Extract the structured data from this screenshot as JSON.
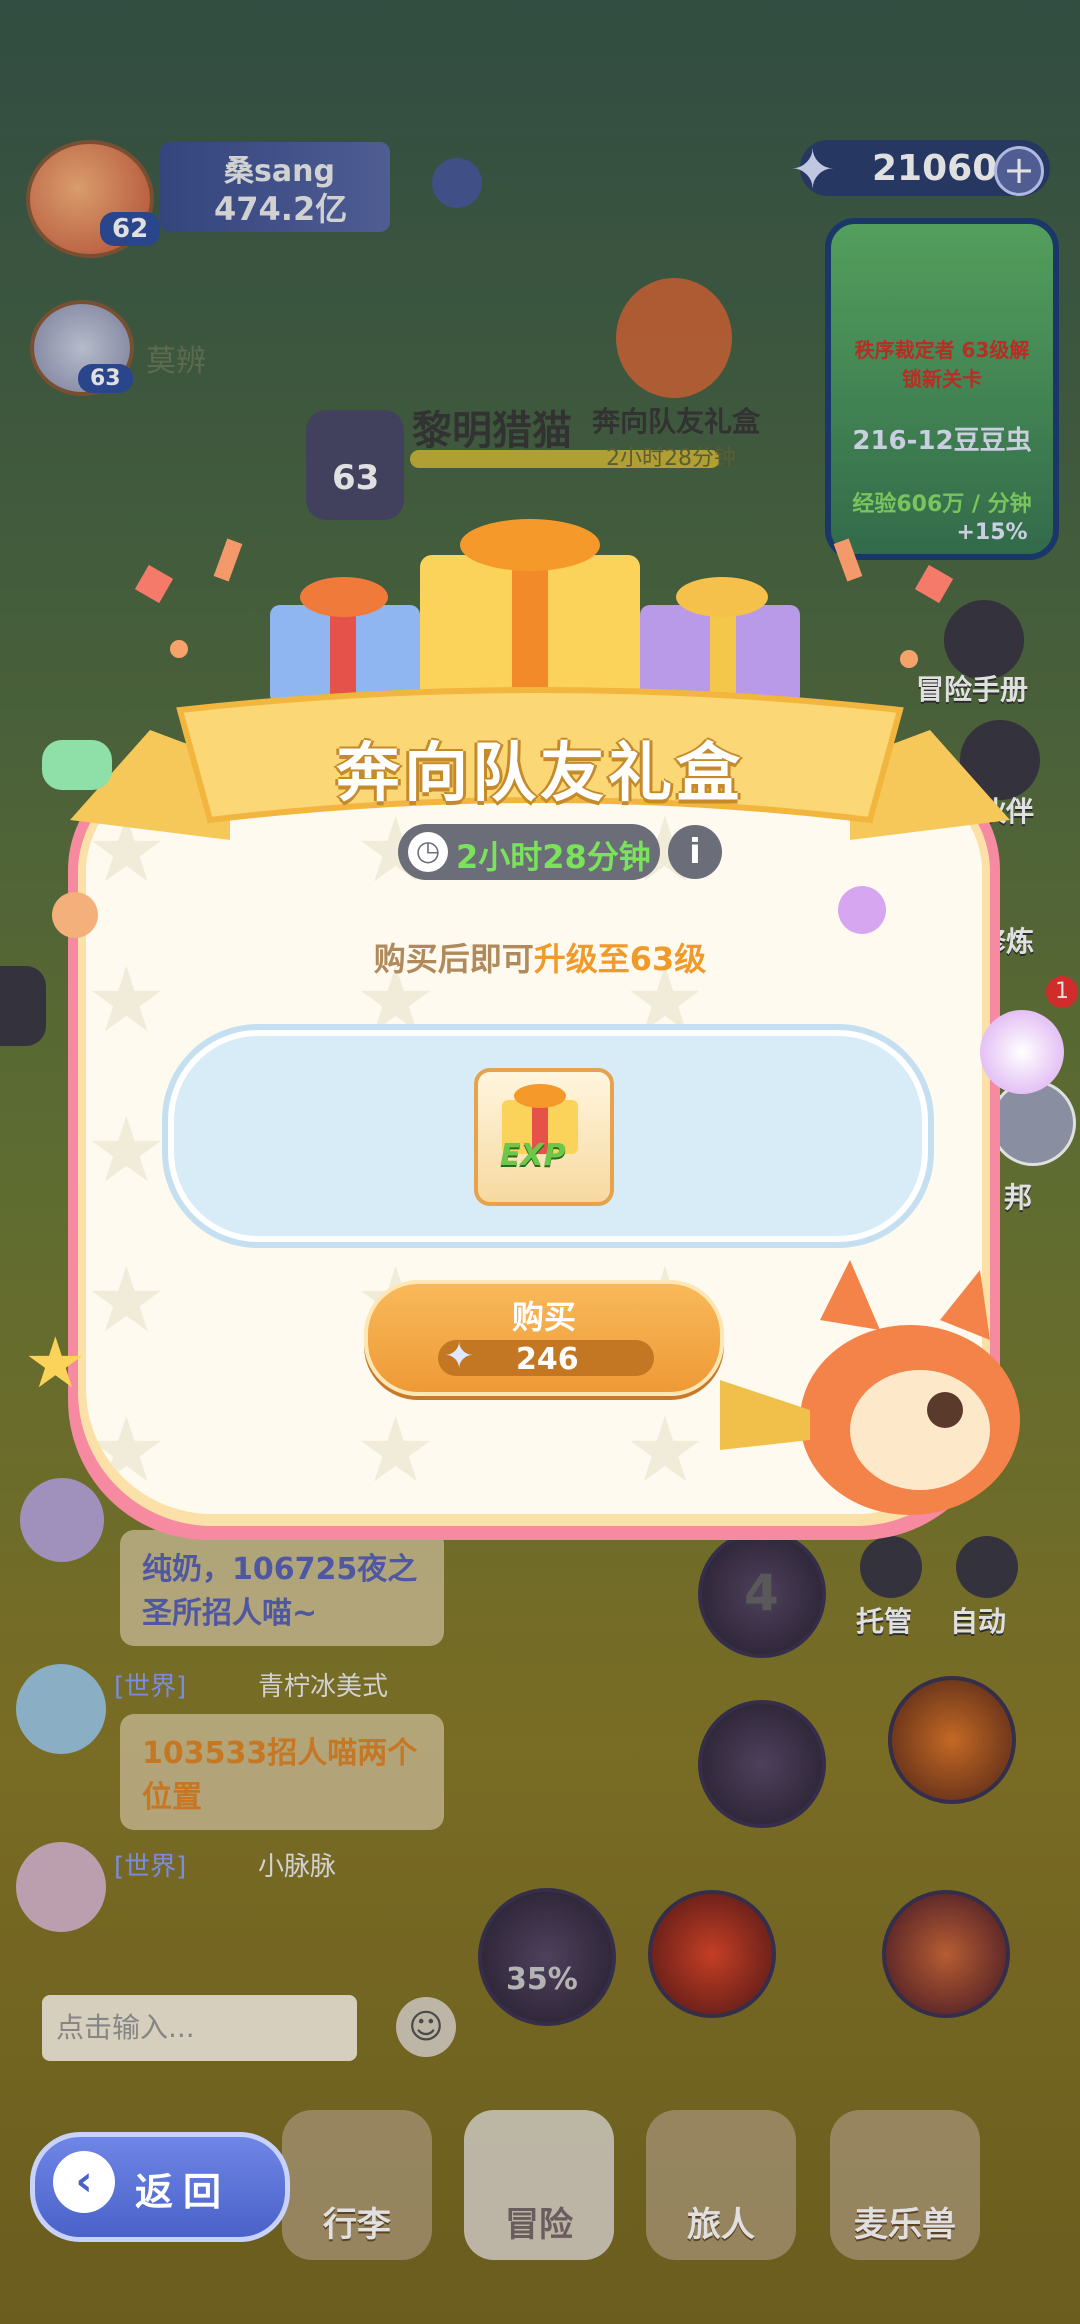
{
  "hud": {
    "player_name": "桑sang",
    "power": "474.2亿",
    "player_level": "62",
    "teammate_name": "莫辨",
    "teammate_level": "63",
    "boss_name": "黎明猎猫",
    "boss_level": "63",
    "gift_label": "奔向队友礼盒",
    "gift_timer": "2小时28分钟",
    "currency": "21060",
    "map_unlock": "秩序裁定者 63级解锁新关卡",
    "stage": "216-12豆豆虫",
    "exp_rate": "经验606万 / 分钟",
    "exp_bonus": "+15%",
    "side_adventure": "冒险手册",
    "side_partner": "伙伴",
    "side_train": "修炼",
    "side_bang": "邦",
    "notif_count": "1",
    "host_label": "托管",
    "auto_label": "自动",
    "skill_percent": "35%",
    "skill_count": "4"
  },
  "chat": {
    "msg1_text": "纯奶，106725夜之圣所招人喵~",
    "msg2_tag": "[世界]",
    "msg2_name": "青柠冰美式",
    "msg2_text": "103533招人喵两个位置",
    "msg3_tag": "[世界]",
    "msg3_name": "小脉脉",
    "input_placeholder": "点击输入..."
  },
  "bottom_nav": {
    "bag": "行李",
    "adventure": "冒险",
    "traveler": "旅人",
    "beast": "麦乐兽",
    "back": "返回"
  },
  "modal": {
    "title": "奔向队友礼盒",
    "timer": "2小时28分钟",
    "upgrade_prefix": "购买后即可",
    "upgrade_highlight": "升级至63级",
    "item_label": "EXP",
    "buy_label": "购买",
    "price": "246"
  },
  "colors": {
    "accent_orange": "#ee9a36",
    "timer_green": "#7be35a",
    "highlight": "#f09a2a",
    "frame_pink": "#f58aa0"
  }
}
